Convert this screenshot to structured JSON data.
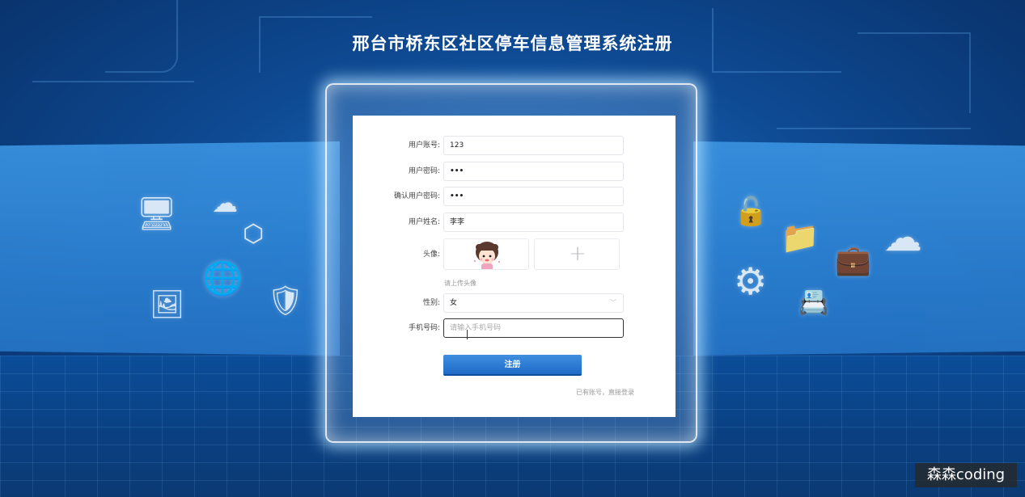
{
  "page_title": "邢台市桥东区社区停车信息管理系统注册",
  "form": {
    "username_label": "用户账号:",
    "username_value": "123",
    "password_label": "用户密码:",
    "password_value": "•••",
    "confirm_password_label": "确认用户密码:",
    "confirm_password_value": "•••",
    "realname_label": "用户姓名:",
    "realname_value": "李李",
    "avatar_label": "头像:",
    "avatar_hint": "请上传头像",
    "avatar_add_icon": "+",
    "gender_label": "性别:",
    "gender_value": "女",
    "gender_arrow": "﹀",
    "phone_label": "手机号码:",
    "phone_placeholder": "请输入手机号码",
    "register_button": "注册",
    "login_link": "已有账号，直接登录"
  },
  "watermark": "森森coding",
  "colors": {
    "background": "#0e4a93",
    "button": "#2a78d2",
    "card": "#ffffff"
  }
}
